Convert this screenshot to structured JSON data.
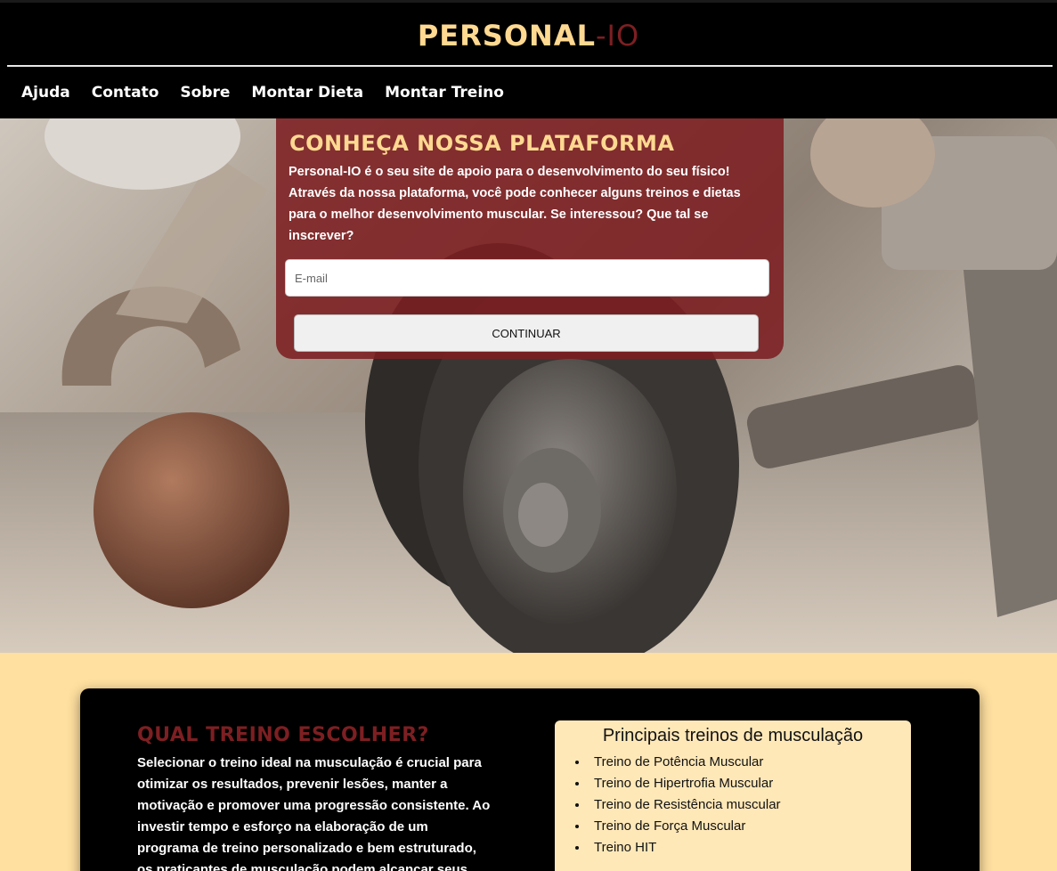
{
  "header": {
    "brand_part1": "PERSONAL",
    "brand_part2": "-IO",
    "nav": [
      {
        "label": "Ajuda"
      },
      {
        "label": "Contato"
      },
      {
        "label": "Sobre"
      },
      {
        "label": "Montar Dieta"
      },
      {
        "label": "Montar Treino"
      }
    ]
  },
  "hero": {
    "title": "CONHEÇA NOSSA PLATAFORMA",
    "text": "Personal-IO é o seu site de apoio para o desenvolvimento do seu físico! Através da nossa plataforma, você pode conhecer alguns treinos e dietas para o melhor desenvolvimento muscular. Se interessou? Que tal se inscrever?",
    "email_placeholder": "E-mail",
    "email_value": "",
    "button_label": "CONTINUAR"
  },
  "section": {
    "title": "QUAL TREINO ESCOLHER?",
    "text": "Selecionar o treino ideal na musculação é crucial para otimizar os resultados, prevenir lesões, manter a motivação e promover uma progressão consistente. Ao investir tempo e esforço na elaboração de um programa de treino personalizado e bem estruturado, os praticantes de musculação podem alcançar seus objetivos de forma",
    "box_title": "Principais treinos de musculação",
    "box_items": [
      "Treino de Potência Muscular",
      "Treino de Hipertrofia Muscular",
      "Treino de Resistência muscular",
      "Treino de Força Muscular",
      "Treino HIT"
    ]
  },
  "colors": {
    "accent_gold": "#ffd991",
    "accent_maroon": "#7d1f22",
    "page_bg": "#ffe0a0"
  }
}
